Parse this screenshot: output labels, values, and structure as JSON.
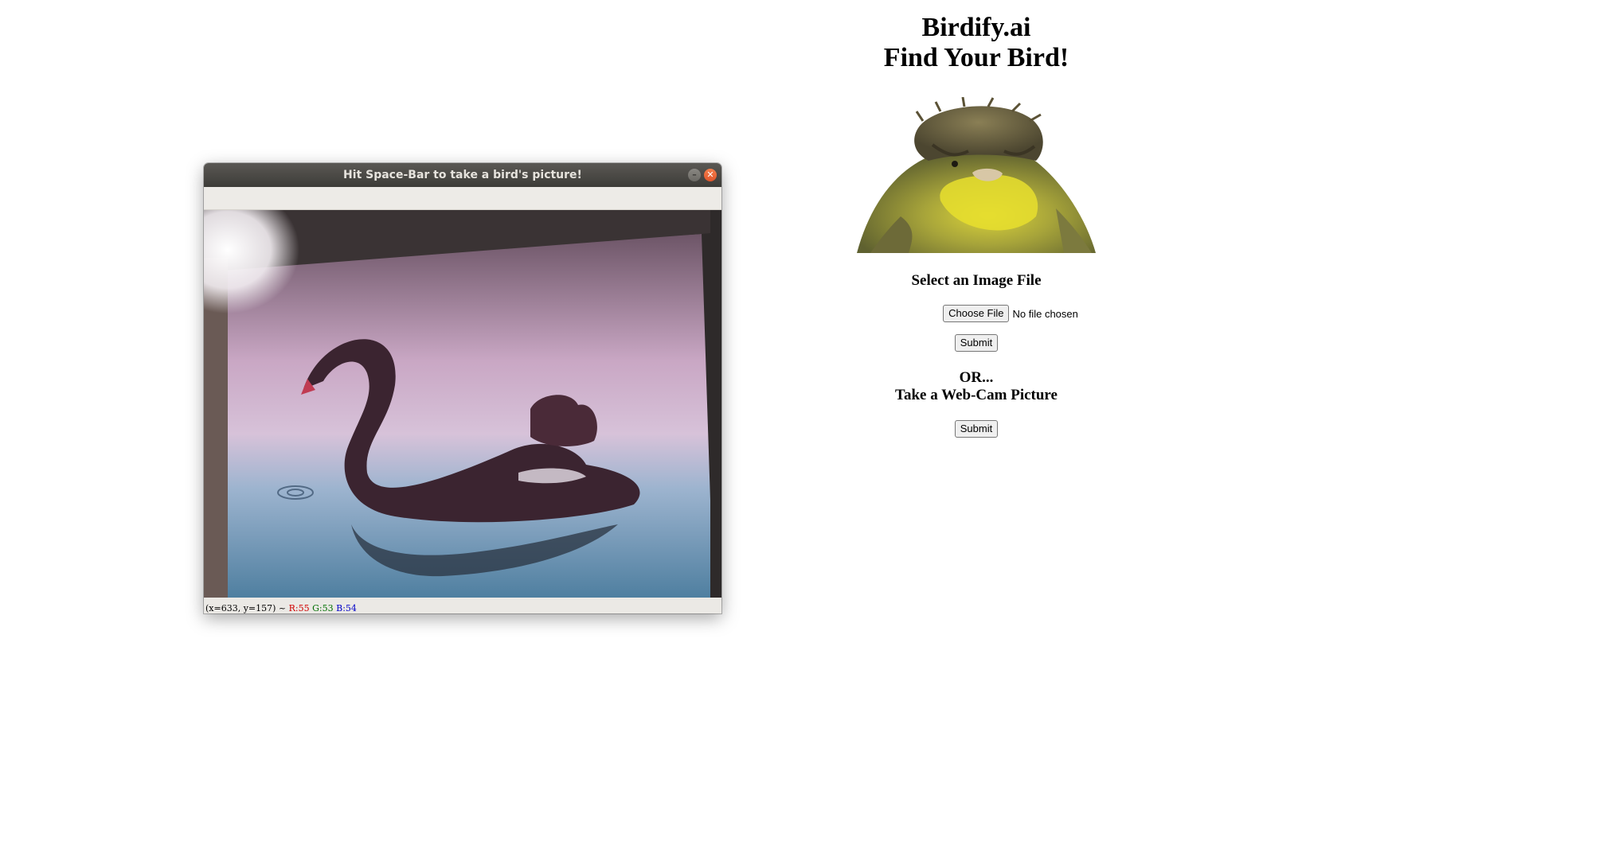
{
  "page": {
    "title": "Birdify.ai",
    "subtitle": "Find Your Bird!",
    "upload_heading": "Select an Image File",
    "choose_file_label": "Choose File",
    "file_status": "No file chosen",
    "submit_label": "Submit",
    "or_heading": "OR...",
    "webcam_heading": "Take a Web-Cam Picture",
    "webcam_submit_label": "Submit"
  },
  "camera_window": {
    "title": "Hit Space-Bar to take a bird's picture!",
    "status": {
      "coords": "(x=633, y=157) ~",
      "r": "R:55",
      "g": "G:53",
      "b": "B:54"
    }
  },
  "colors": {
    "titlebar": "#3d3c38",
    "close_button": "#e0552b",
    "status_red": "#d00000",
    "status_green": "#007000",
    "status_blue": "#0000c8"
  }
}
